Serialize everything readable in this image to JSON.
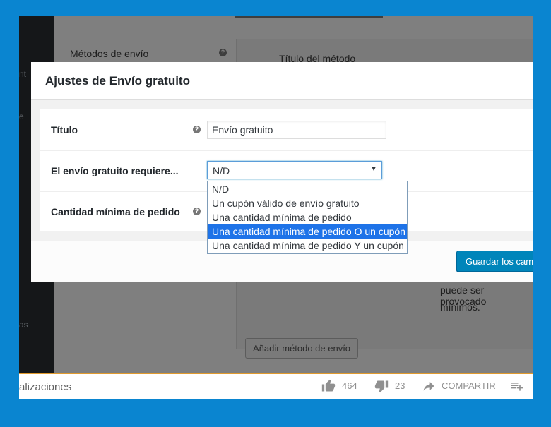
{
  "background": {
    "sidebar_fragments": [
      "nt",
      "e",
      "as"
    ],
    "methods_label": "Métodos de envío",
    "column_title": "Título del método",
    "text_line1": "puede ser provocado",
    "text_line2": "mínimos.",
    "add_method_button": "Añadir método de envío"
  },
  "modal": {
    "title": "Ajustes de Envío gratuito",
    "rows": [
      {
        "label": "Título",
        "value": "Envío gratuito"
      },
      {
        "label": "El envío gratuito requiere...",
        "value": "N/D"
      },
      {
        "label": "Cantidad mínima de pedido"
      }
    ],
    "help_glyph": "?",
    "dropdown_arrow": "▼",
    "save_button": "Guardar los cambios",
    "options": [
      "N/D",
      "Un cupón válido de envío gratuito",
      "Una cantidad mínima de pedido",
      "Una cantidad mínima de pedido O un cupón",
      "Una cantidad mínima de pedido Y un cupón"
    ],
    "highlighted_option_index": 3
  },
  "video_bar": {
    "views_text": "alizaciones",
    "likes": "464",
    "dislikes": "23",
    "share": "COMPARTIR"
  },
  "colors": {
    "frame_blue": "#0a85d0",
    "primary_button": "#0085ba",
    "option_highlight": "#1e73e8",
    "progress_accent": "#e09a2e"
  }
}
